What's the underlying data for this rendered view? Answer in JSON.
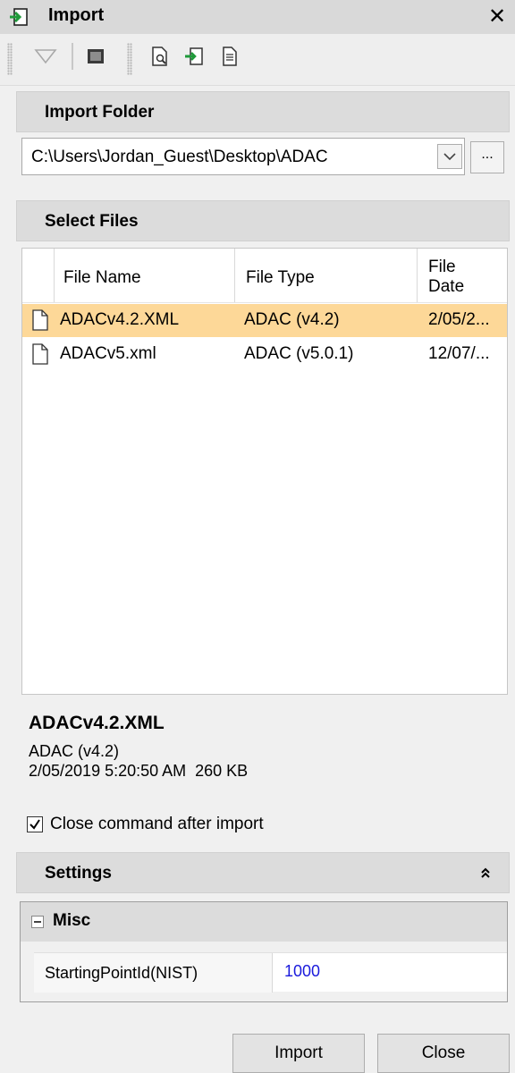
{
  "window": {
    "title": "Import",
    "title_icon": "import-arrow-icon",
    "close_glyph": "✕"
  },
  "toolbar": {
    "icons": [
      "filter-icon",
      "view-icon",
      "preview-icon",
      "import-icon",
      "document-icon"
    ]
  },
  "import_folder": {
    "header": "Import Folder",
    "path": "C:\\Users\\Jordan_Guest\\Desktop\\ADAC",
    "browse_label": "..."
  },
  "select_files": {
    "header": "Select Files",
    "columns": {
      "name": "File Name",
      "type": "File Type",
      "date_line1": "File",
      "date_line2": "Date"
    },
    "rows": [
      {
        "name": "ADACv4.2.XML",
        "type": "ADAC (v4.2)",
        "date": "2/05/2...",
        "selected": true
      },
      {
        "name": "ADACv5.xml",
        "type": "ADAC (v5.0.1)",
        "date": "12/07/...",
        "selected": false
      }
    ]
  },
  "details": {
    "name": "ADACv4.2.XML",
    "type": "ADAC (v4.2)",
    "date_size": "2/05/2019 5:20:50 AM  260 KB"
  },
  "close_after_import": {
    "label": "Close command after import",
    "checked": true
  },
  "settings": {
    "header": "Settings",
    "collapse_glyph": "⌃",
    "category": "Misc",
    "properties": [
      {
        "name": "StartingPointId(NIST)",
        "value": "1000"
      }
    ]
  },
  "buttons": {
    "import": "Import",
    "close": "Close"
  },
  "colors": {
    "selection": "#fdd898",
    "header_bg": "#dcdcdc",
    "value_blue": "#1a1adc"
  }
}
